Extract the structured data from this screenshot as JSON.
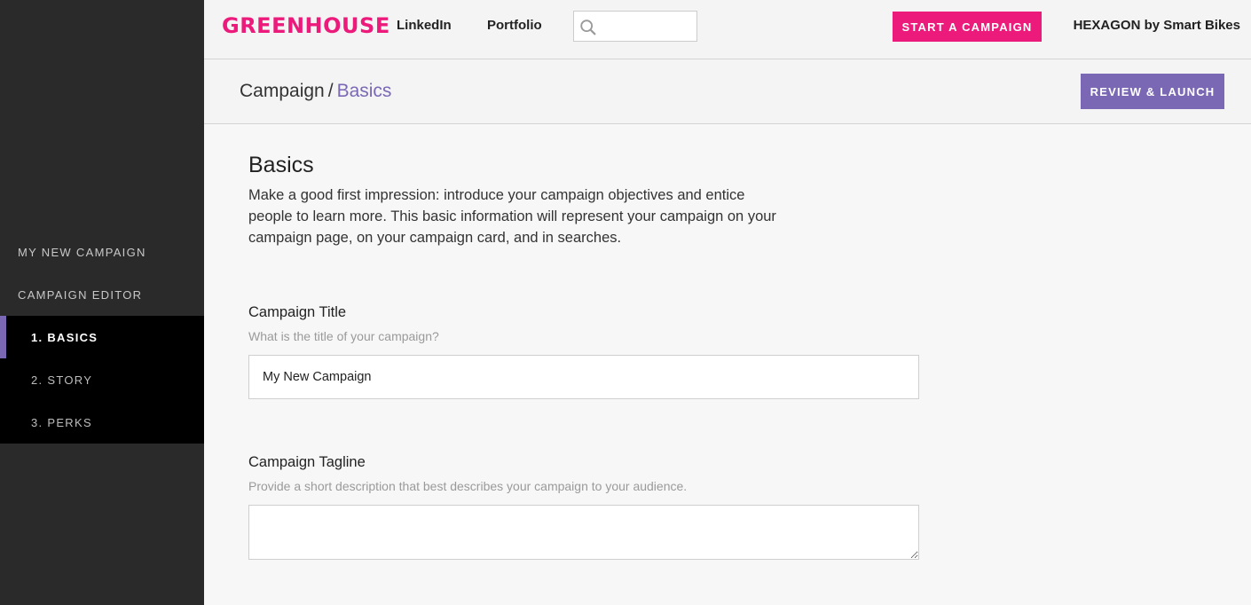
{
  "sidebar": {
    "my_campaign": "MY NEW CAMPAIGN",
    "campaign_editor": "CAMPAIGN EDITOR",
    "steps": [
      {
        "label": "1. BASICS",
        "active": true
      },
      {
        "label": "2. STORY",
        "active": false
      },
      {
        "label": "3. PERKS",
        "active": false
      }
    ]
  },
  "header": {
    "logo": "GREENHOUSE",
    "nav": [
      "LinkedIn",
      "Portfolio"
    ],
    "search": {
      "value": "",
      "placeholder": ""
    },
    "start_button": "START A CAMPAIGN",
    "user": "HEXAGON by Smart Bikes"
  },
  "breadcrumb": {
    "parent": "Campaign",
    "separator": "/",
    "current": "Basics",
    "review_button": "REVIEW & LAUNCH"
  },
  "main": {
    "title": "Basics",
    "intro": "Make a good first impression: introduce your campaign objectives and entice people to learn more. This basic information will represent your campaign on your campaign page, on your campaign card, and in searches.",
    "fields": {
      "title": {
        "label": "Campaign Title",
        "hint": "What is the title of your campaign?",
        "value": "My New Campaign"
      },
      "tagline": {
        "label": "Campaign Tagline",
        "hint": "Provide a short description that best describes your campaign to your audience.",
        "value": ""
      }
    }
  },
  "colors": {
    "brand": "#ec1a7a",
    "accent": "#7b68b5",
    "sidebar_bg": "#2a2a2a",
    "steps_bg": "#000000"
  }
}
